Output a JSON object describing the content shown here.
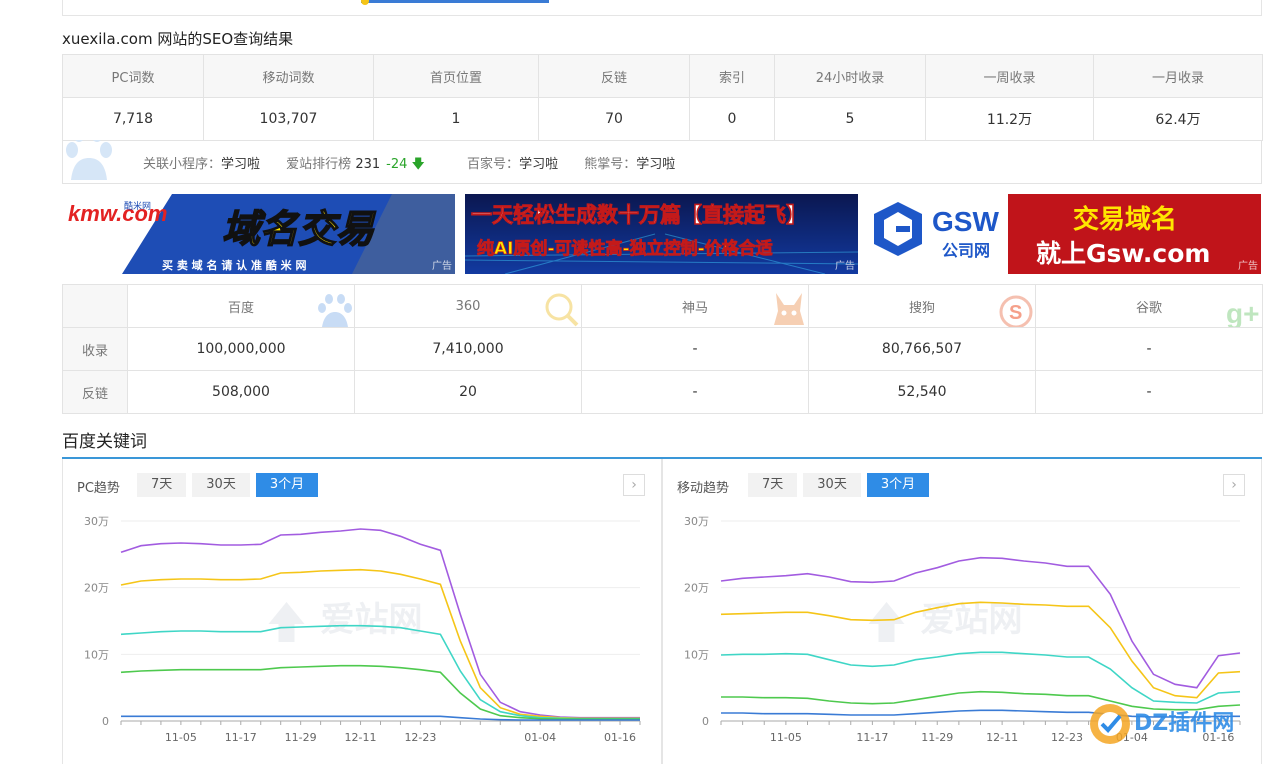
{
  "seo": {
    "title": "xuexila.com 网站的SEO查询结果",
    "headers": [
      "PC词数",
      "移动词数",
      "首页位置",
      "反链",
      "索引",
      "24小时收录",
      "一周收录",
      "一月收录"
    ],
    "values": [
      "7,718",
      "103,707",
      "1",
      "70",
      "0",
      "5",
      "11.2万",
      "62.4万"
    ]
  },
  "related": {
    "miniapp_label": "关联小程序：",
    "miniapp_value": "学习啦",
    "rank_label": "爱站排行榜",
    "rank_value": "231",
    "rank_change": "-24",
    "baijia_label": "百家号：",
    "baijia_value": "学习啦",
    "xiongzhang_label": "熊掌号：",
    "xiongzhang_value": "学习啦"
  },
  "ads": {
    "ad1_brand": "kmw.com",
    "ad1_brand_cn": "酷米网",
    "ad1_headline": "域名交易",
    "ad1_sub": "买 卖 域 名 请 认 准 酷 米 网",
    "ad2_line1": "一天轻松生成数十万篇【直接起飞】",
    "ad2_line2": "纯AI原创-可读性高-独立控制-价格合适",
    "ad3_brand": "GSW",
    "ad3_brand_cn": "公司网",
    "ad3_line1": "交易域名",
    "ad3_line2": "就上Gsw.com",
    "tag": "广告"
  },
  "engines": {
    "headers": [
      "百度",
      "360",
      "神马",
      "搜狗",
      "谷歌"
    ],
    "icons": [
      "paw-icon",
      "magnifier-icon",
      "shenma-icon",
      "sogou-icon",
      "google-plus-icon"
    ],
    "rows": [
      {
        "label": "收录",
        "values": [
          "100,000,000",
          "7,410,000",
          "-",
          "80,766,507",
          "-"
        ]
      },
      {
        "label": "反链",
        "values": [
          "508,000",
          "20",
          "-",
          "52,540",
          "-"
        ]
      }
    ]
  },
  "keywords": {
    "title": "百度关键词",
    "pc_title": "PC趋势",
    "mobile_title": "移动趋势",
    "tabs": [
      "7天",
      "30天",
      "3个月"
    ],
    "active_tab": "3个月",
    "next": "›"
  },
  "watermark": "爱站网",
  "corner_logo": "DZ插件网",
  "chart_data": [
    {
      "type": "line",
      "title": "PC趋势",
      "x": [
        "10-25",
        "10-29",
        "11-02",
        "11-05",
        "11-09",
        "11-13",
        "11-17",
        "11-21",
        "11-25",
        "11-29",
        "12-03",
        "12-07",
        "12-11",
        "12-15",
        "12-19",
        "12-23",
        "12-25",
        "12-27",
        "12-29",
        "12-31",
        "01-02",
        "01-04",
        "01-06",
        "01-08",
        "01-12",
        "01-16",
        "01-19"
      ],
      "xticks": [
        "11-05",
        "11-17",
        "11-29",
        "12-11",
        "12-23",
        "01-04",
        "01-16"
      ],
      "yticks": [
        "0",
        "10万",
        "20万",
        "30万"
      ],
      "ylim": [
        0,
        300000
      ],
      "series": [
        {
          "color": "#a25ce0",
          "values": [
            253000,
            263000,
            266000,
            267000,
            266000,
            264000,
            264000,
            265000,
            279000,
            280000,
            283000,
            285000,
            288000,
            286000,
            277000,
            265000,
            256000,
            160000,
            70000,
            28000,
            14000,
            9000,
            6000,
            5000,
            5000,
            5000,
            5000
          ]
        },
        {
          "color": "#f5c518",
          "values": [
            204000,
            210000,
            212000,
            213000,
            213000,
            212000,
            212000,
            213000,
            222000,
            223000,
            225000,
            226000,
            227000,
            225000,
            220000,
            213000,
            205000,
            120000,
            50000,
            20000,
            10000,
            7000,
            5000,
            4000,
            4000,
            4000,
            4000
          ]
        },
        {
          "color": "#3fd6c6",
          "values": [
            130000,
            132000,
            134000,
            135000,
            135000,
            134000,
            134000,
            134000,
            140000,
            141000,
            142000,
            143000,
            143000,
            142000,
            140000,
            135000,
            130000,
            75000,
            32000,
            14000,
            8000,
            5000,
            4000,
            3500,
            3500,
            3500,
            3500
          ]
        },
        {
          "color": "#4ec94e",
          "values": [
            73000,
            75000,
            76000,
            77000,
            77000,
            77000,
            77000,
            77000,
            80000,
            81000,
            82000,
            83000,
            83000,
            82000,
            80000,
            77000,
            73000,
            42000,
            18000,
            8000,
            5000,
            3500,
            3000,
            3000,
            3000,
            3000,
            3000
          ]
        },
        {
          "color": "#3a7bd5",
          "values": [
            7000,
            7000,
            7000,
            7000,
            7000,
            7000,
            7000,
            7000,
            7000,
            7000,
            7000,
            7000,
            7000,
            7000,
            7000,
            7000,
            7000,
            5000,
            3000,
            2000,
            1500,
            1500,
            1500,
            1500,
            1500,
            1500,
            1500
          ]
        }
      ]
    },
    {
      "type": "line",
      "title": "移动趋势",
      "x": [
        "10-25",
        "10-29",
        "11-02",
        "11-05",
        "11-09",
        "11-11",
        "11-13",
        "11-17",
        "11-21",
        "11-25",
        "11-29",
        "12-03",
        "12-07",
        "12-11",
        "12-15",
        "12-19",
        "12-23",
        "12-25",
        "12-29",
        "01-02",
        "01-06",
        "01-10",
        "01-13",
        "01-16",
        "01-19"
      ],
      "xticks": [
        "11-05",
        "11-17",
        "11-29",
        "12-11",
        "12-23",
        "01-04",
        "01-16"
      ],
      "yticks": [
        "0",
        "10万",
        "20万",
        "30万"
      ],
      "ylim": [
        0,
        300000
      ],
      "series": [
        {
          "color": "#a25ce0",
          "values": [
            210000,
            214000,
            216000,
            218000,
            221000,
            216000,
            209000,
            208000,
            210000,
            222000,
            230000,
            240000,
            245000,
            244000,
            240000,
            237000,
            232000,
            232000,
            190000,
            120000,
            70000,
            55000,
            50000,
            98000,
            102000
          ]
        },
        {
          "color": "#f5c518",
          "values": [
            160000,
            161000,
            162000,
            163000,
            163000,
            158000,
            152000,
            151000,
            152000,
            163000,
            170000,
            176000,
            178000,
            177000,
            175000,
            174000,
            172000,
            172000,
            140000,
            90000,
            50000,
            38000,
            35000,
            72000,
            74000
          ]
        },
        {
          "color": "#3fd6c6",
          "values": [
            99000,
            100000,
            100000,
            101000,
            100000,
            92000,
            84000,
            82000,
            84000,
            92000,
            96000,
            101000,
            103000,
            103000,
            101000,
            99000,
            96000,
            96000,
            78000,
            50000,
            30000,
            28000,
            27000,
            42000,
            44000
          ]
        },
        {
          "color": "#4ec94e",
          "values": [
            36000,
            36000,
            35000,
            35000,
            34000,
            30000,
            27000,
            26000,
            27000,
            32000,
            37000,
            42000,
            44000,
            43000,
            41000,
            40000,
            38000,
            38000,
            30000,
            22000,
            18000,
            17000,
            17000,
            22000,
            24000
          ]
        },
        {
          "color": "#3a7bd5",
          "values": [
            12000,
            12000,
            11000,
            11000,
            11000,
            10000,
            9000,
            9000,
            9000,
            11000,
            13000,
            15000,
            16000,
            16000,
            15000,
            14000,
            13000,
            13000,
            10000,
            7000,
            6000,
            6000,
            6000,
            7000,
            7000
          ]
        }
      ]
    }
  ]
}
